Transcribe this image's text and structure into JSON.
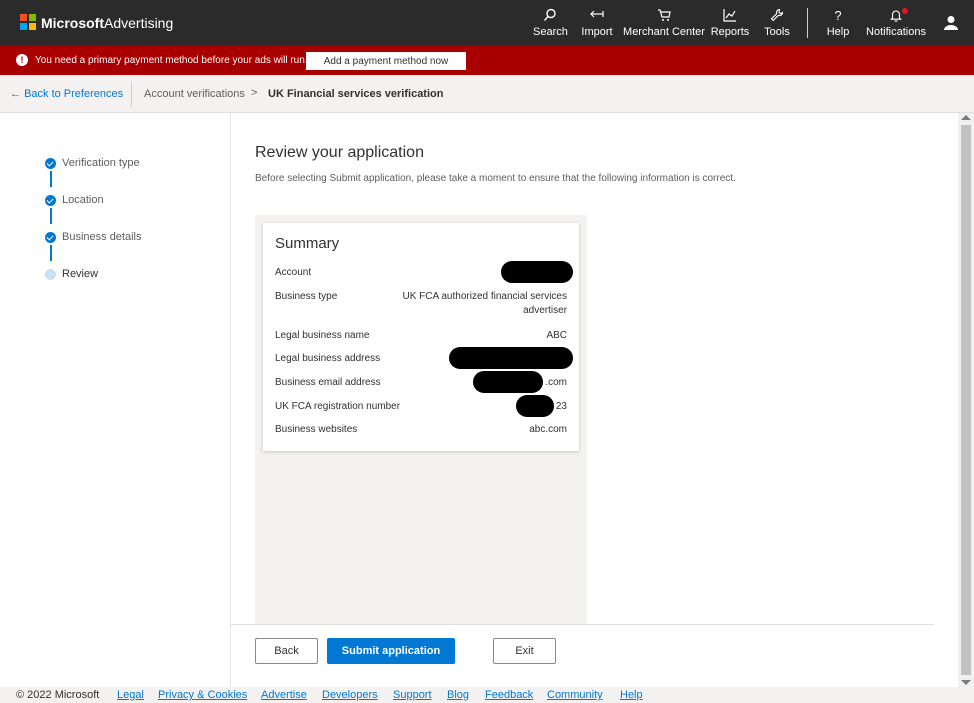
{
  "header": {
    "brand": "Microsoft",
    "product": "Advertising",
    "nav": [
      {
        "label": "Search",
        "icon": "search-icon"
      },
      {
        "label": "Import",
        "icon": "import-icon"
      },
      {
        "label": "Merchant Center",
        "icon": "cart-icon"
      },
      {
        "label": "Reports",
        "icon": "chart-icon"
      },
      {
        "label": "Tools",
        "icon": "wrench-icon"
      },
      {
        "label": "Help",
        "icon": "question-icon"
      },
      {
        "label": "Notifications",
        "icon": "bell-icon"
      }
    ]
  },
  "alert": {
    "text": "You need a primary payment method before your ads will run.",
    "button": "Add a payment method now",
    "color": "#a80000"
  },
  "breadcrumb": {
    "back": "Back to Preferences",
    "items": [
      "Account verifications",
      "UK Financial services verification"
    ]
  },
  "steps": [
    {
      "label": "Verification type",
      "state": "done"
    },
    {
      "label": "Location",
      "state": "done"
    },
    {
      "label": "Business details",
      "state": "done"
    },
    {
      "label": "Review",
      "state": "current"
    }
  ],
  "content": {
    "title": "Review your application",
    "description": "Before selecting Submit application, please take a moment to ensure that the following information is correct."
  },
  "summary": {
    "title": "Summary",
    "rows": [
      {
        "key": "Account",
        "value": ""
      },
      {
        "key": "Business type",
        "value": "UK FCA authorized financial services",
        "value2": "advertiser"
      },
      {
        "key": "Legal business name",
        "value": "ABC"
      },
      {
        "key": "Legal business address",
        "value": ""
      },
      {
        "key": "Business email address",
        "value": ".com"
      },
      {
        "key": "UK FCA registration number",
        "value": "23"
      },
      {
        "key": "Business websites",
        "value": "abc.com"
      }
    ]
  },
  "actions": {
    "back": "Back",
    "submit": "Submit application",
    "exit": "Exit"
  },
  "footer": {
    "copyright": "© 2022 Microsoft",
    "links": [
      "Legal",
      "Privacy & Cookies",
      "Advertise",
      "Developers",
      "Support",
      "Blog",
      "Feedback",
      "Community",
      "Help"
    ]
  },
  "colors": {
    "accent": "#0078d4",
    "topbar": "#2b2b2b"
  }
}
